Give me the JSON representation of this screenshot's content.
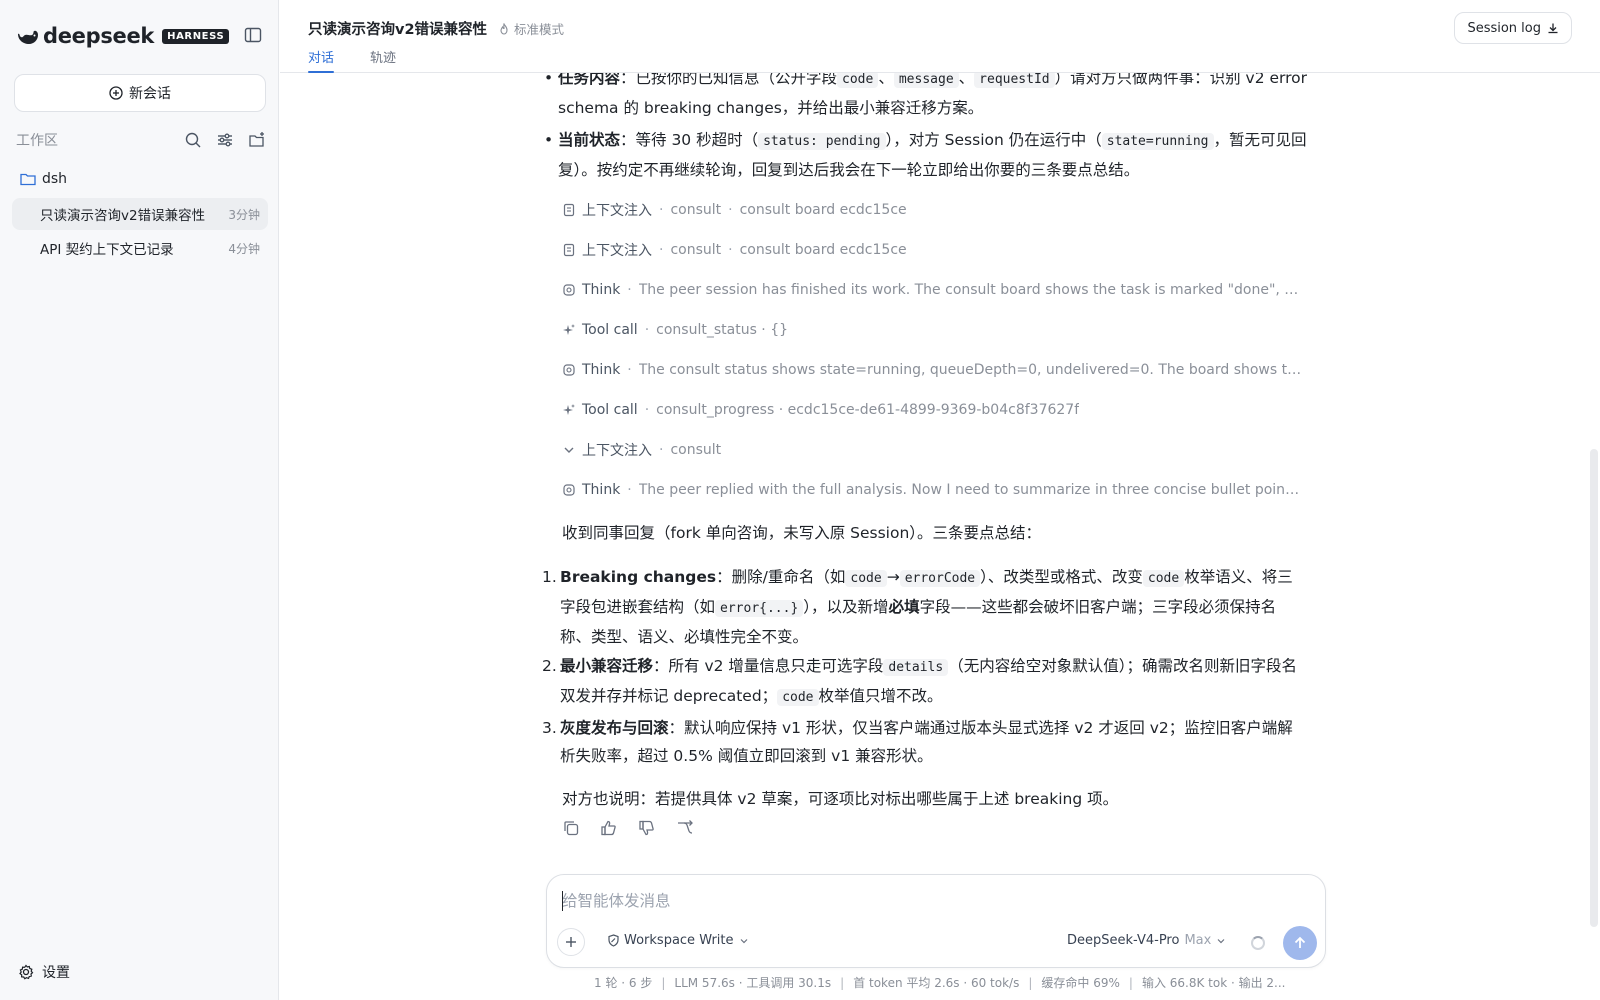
{
  "brand": {
    "name": "deepseek",
    "badge": "HARNESS"
  },
  "sidebar": {
    "new_chat": "新会话",
    "workspace_label": "工作区",
    "folder": "dsh",
    "chats": [
      {
        "title": "只读演示咨询v2错误兼容性",
        "time": "3分钟"
      },
      {
        "title": "API 契约上下文已记录",
        "time": "4分钟"
      }
    ],
    "settings": "设置"
  },
  "header": {
    "title": "只读演示咨询v2错误兼容性",
    "mode": "标准模式",
    "tabs": [
      "对话",
      "轨迹"
    ],
    "session_log": "Session log"
  },
  "message": {
    "bullet1": {
      "label": "任务内容",
      "t1": "：已按你的已知信息（公开字段",
      "c1": "code",
      "s1": "、",
      "c2": "message",
      "s2": "、",
      "c3": "requestId",
      "t2": "）请对方只做两件事：识别 v2 error schema 的 breaking changes，并给出最小兼容迁移方案。"
    },
    "bullet2": {
      "label": "当前状态",
      "t1": "：等待 30 秒超时（",
      "c1": "status: pending",
      "t2": "），对方 Session 仍在运行中（",
      "c2": "state=running",
      "t3": "，暂无可见回复）。按约定不再继续轮询，回复到达后我会在下一轮立即给出你要的三条要点总结。"
    }
  },
  "trace": [
    {
      "icon": "document-icon",
      "kind": "上下文注入",
      "sep": "·",
      "detail": "consult",
      "extra": "consult board ecdc15ce"
    },
    {
      "icon": "document-icon",
      "kind": "上下文注入",
      "sep": "·",
      "detail": "consult",
      "extra": "consult board ecdc15ce"
    },
    {
      "icon": "think-icon",
      "kind": "Think",
      "sep": "·",
      "detail": "The peer session has finished its work. The consult board shows the task is marked \"done\", and the p..."
    },
    {
      "icon": "sparkle-icon",
      "kind": "Tool call",
      "sep": "·",
      "detail": "consult_status · {}"
    },
    {
      "icon": "think-icon",
      "kind": "Think",
      "sep": "·",
      "detail": "The consult status shows state=running, queueDepth=0, undelivered=0. The board shows the task ma..."
    },
    {
      "icon": "sparkle-icon",
      "kind": "Tool call",
      "sep": "·",
      "detail": "consult_progress · ecdc15ce-de61-4899-9369-b04c8f37627f"
    },
    {
      "icon": "chevron-down-icon",
      "kind": "上下文注入",
      "sep": "·",
      "detail": "consult"
    },
    {
      "icon": "think-icon",
      "kind": "Think",
      "sep": "·",
      "detail": "The peer replied with the full analysis. Now I need to summarize in three concise bullet points as the u..."
    }
  ],
  "summary": {
    "intro": "收到同事回复（fork 单向咨询，未写入原 Session）。三条要点总结：",
    "items": [
      {
        "num": "1.",
        "label": "Breaking changes",
        "t1": "：删除/重命名（如",
        "c1": "code",
        "arrow": "→",
        "c2": "errorCode",
        "t2": "）、改类型或格式、改变",
        "c3": "code",
        "t3": "枚举语义、将三字段包进嵌套结构（如",
        "c4": "error{...}",
        "t4": "），以及新增",
        "b1": "必填",
        "t5": "字段——这些都会破坏旧客户端；三字段必须保持名称、类型、语义、必填性完全不变。"
      },
      {
        "num": "2.",
        "label": "最小兼容迁移",
        "t1": "：所有 v2 增量信息只走可选字段",
        "c1": "details",
        "t2": "（无内容给空对象默认值）；确需改名则新旧字段名双发并存并标记 deprecated；",
        "c2": "code",
        "t3": "枚举值只增不改。"
      },
      {
        "num": "3.",
        "label": "灰度发布与回滚",
        "t1": "：默认响应保持 v1 形状，仅当客户端通过版本头显式选择 v2 才返回 v2；监控旧客户端解析失败率，超过 0.5% 阈值立即回滚到 v1 兼容形状。"
      }
    ],
    "outro": "对方也说明：若提供具体 v2 草案，可逐项比对标出哪些属于上述 breaking 项。"
  },
  "composer": {
    "placeholder": "给智能体发消息",
    "mode": "Workspace Write",
    "model": "DeepSeek-V4-Pro",
    "level": "Max"
  },
  "stats": [
    "1 轮 · 6 步",
    "LLM 57.6s · 工具调用 30.1s",
    "首 token 平均 2.6s · 60 tok/s",
    "缓存命中 69%",
    "输入 66.8K tok · 输出 2..."
  ],
  "stats_sep": "|"
}
